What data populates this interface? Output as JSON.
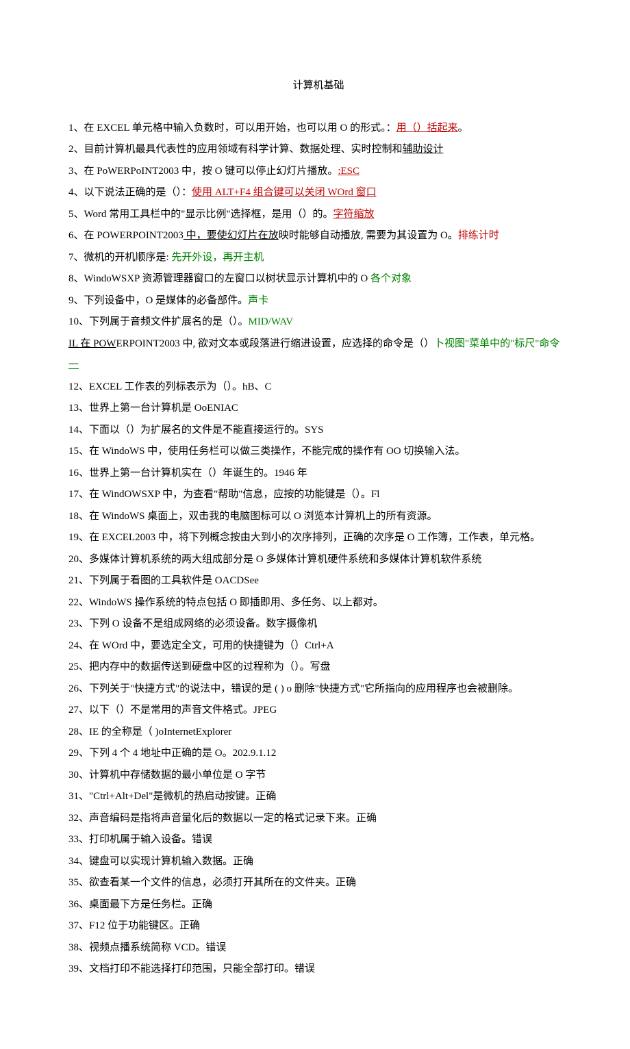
{
  "title": "计算机基础",
  "items": [
    {
      "segments": [
        {
          "text": "1、在 EXCEL 单元格中输入负数时，可以用开始，也可以用 O 的形式。："
        },
        {
          "text": "用（）括起来",
          "underline": true,
          "color": "red"
        },
        {
          "text": "。"
        }
      ]
    },
    {
      "segments": [
        {
          "text": "2、目前计算机最具代表性的应用领域有科学计算、数据处理、实时控制和"
        },
        {
          "text": "辅助设计",
          "underline": true
        }
      ]
    },
    {
      "segments": [
        {
          "text": "3、在 PoWERPoINT2003 中，按 O 键可以停止幻灯片播放。"
        },
        {
          "text": ":ESC",
          "underline": true,
          "color": "red"
        }
      ]
    },
    {
      "segments": [
        {
          "text": "4、以下说法正确的是（）："
        },
        {
          "text": "使用 ALT+F4 组合键可以关闭 WOrd 窗口",
          "underline": true,
          "color": "red"
        }
      ]
    },
    {
      "segments": [
        {
          "text": "5、Word 常用工具栏中的\"显示比例\"选择框，是用（）的。"
        },
        {
          "text": "字符缩放",
          "underline": true,
          "color": "red"
        }
      ]
    },
    {
      "segments": [
        {
          "text": "6、在 POWERPOINT2003"
        },
        {
          "text": " 中，要使幻灯片在放",
          "underline": true
        },
        {
          "text": "映时能够自动播放, 需要为其设置为 O。"
        },
        {
          "text": "排练计时",
          "color": "red"
        }
      ]
    },
    {
      "segments": [
        {
          "text": "7、微机的开机顺序是: "
        },
        {
          "text": "先开外设，再开主机",
          "color": "green"
        }
      ]
    },
    {
      "segments": [
        {
          "text": "8、WindoWSXP 资源管理器窗口的左窗口以树状显示计算机中的 O "
        },
        {
          "text": "各个对象",
          "color": "green"
        }
      ]
    },
    {
      "segments": [
        {
          "text": "9、下列设备中，O 是媒体的必备部件。"
        },
        {
          "text": "声卡",
          "color": "green"
        }
      ]
    },
    {
      "segments": [
        {
          "text": "10、下列属于音频文件扩展名的是（）。"
        },
        {
          "text": "MID/WAV",
          "color": "green"
        }
      ]
    },
    {
      "segments": [
        {
          "text": "IL 在 POW",
          "underline": true
        },
        {
          "text": "ERPOINT2003 中, 欲对文本或段落进行缩进设置，应选择的命令是（）"
        },
        {
          "text": "卜视图\"菜单中的\"标尺\"命令",
          "color": "green"
        }
      ]
    },
    {
      "segments": [
        {
          "text": "一",
          "underline": true,
          "color": "green"
        }
      ]
    },
    {
      "segments": [
        {
          "text": "12、EXCEL 工作表的列标表示为（）。hB、C"
        }
      ]
    },
    {
      "segments": [
        {
          "text": "13、世界上第一台计算机是 OoENIAC"
        }
      ]
    },
    {
      "segments": [
        {
          "text": "14、下面以（）为扩展名的文件是不能直接运行的。SYS"
        }
      ]
    },
    {
      "segments": [
        {
          "text": "15、在 WindoWS 中，使用任务栏可以做三类操作，不能完成的操作有 OO 切换输入法。"
        }
      ]
    },
    {
      "segments": [
        {
          "text": "16、世界上第一台计算机实在（）年诞生的。1946 年"
        }
      ]
    },
    {
      "segments": [
        {
          "text": "17、在 WindOWSXP 中，为查看\"帮助\"信息，应按的功能键是（）。Fl"
        }
      ]
    },
    {
      "segments": [
        {
          "text": "18、在 WindoWS 桌面上，双击我的电脑图标可以 O 浏览本计算机上的所有资源。"
        }
      ]
    },
    {
      "segments": [
        {
          "text": "19、在 EXCEL2003 中，将下列概念按由大到小的次序排列，正确的次序是 O 工作簿，工作表，单元格。"
        }
      ]
    },
    {
      "segments": [
        {
          "text": "20、多媒体计算机系统的两大组成部分是 O 多媒体计算机硬件系统和多媒体计算机软件系统"
        }
      ]
    },
    {
      "segments": [
        {
          "text": "21、下列属于看图的工具软件是 OACDSee"
        }
      ]
    },
    {
      "segments": [
        {
          "text": "22、WindoWS 操作系统的特点包括 O 即插即用、多任务、以上都对。"
        }
      ]
    },
    {
      "segments": [
        {
          "text": "23、下列 O 设备不是组成网络的必须设备。数字摄像机"
        }
      ]
    },
    {
      "segments": [
        {
          "text": "24、在 WOrd 中，要选定全文，可用的快捷键为（）Ctrl+A"
        }
      ]
    },
    {
      "segments": [
        {
          "text": "25、把内存中的数据传送到硬盘中区的过程称为（）。写盘"
        }
      ]
    },
    {
      "segments": [
        {
          "text": "26、下列关于\"快捷方式\"的说法中，错误的是 ( ) o 删除\"快捷方式\"它所指向的应用程序也会被删除。"
        }
      ]
    },
    {
      "segments": [
        {
          "text": "27、以下（）不是常用的声音文件格式。JPEG"
        }
      ]
    },
    {
      "segments": [
        {
          "text": "28、IE 的全称是（  )oInternetExplorer"
        }
      ]
    },
    {
      "segments": [
        {
          "text": "29、下列 4 个 4 地址中正确的是 O。202.9.1.12"
        }
      ]
    },
    {
      "segments": [
        {
          "text": "30、计算机中存储数据的最小单位是 O 字节"
        }
      ]
    },
    {
      "segments": [
        {
          "text": "31、\"Ctrl+Alt+Del\"是微机的热启动按键。正确"
        }
      ]
    },
    {
      "segments": [
        {
          "text": "32、声音编码是指将声音量化后的数据以一定的格式记录下来。正确"
        }
      ]
    },
    {
      "segments": [
        {
          "text": "33、打印机属于输入设备。错误"
        }
      ]
    },
    {
      "segments": [
        {
          "text": "34、键盘可以实现计算机输入数据。正确"
        }
      ]
    },
    {
      "segments": [
        {
          "text": "35、欲查看某一个文件的信息，必须打开其所在的文件夹。正确"
        }
      ]
    },
    {
      "segments": [
        {
          "text": "36、桌面最下方是任务栏。正确"
        }
      ]
    },
    {
      "segments": [
        {
          "text": "37、F12 位于功能键区。正确"
        }
      ]
    },
    {
      "segments": [
        {
          "text": "38、视频点播系统简称 VCD。错误"
        }
      ]
    },
    {
      "segments": [
        {
          "text": "39、文档打印不能选择打印范围，只能全部打印。错误"
        }
      ]
    }
  ]
}
